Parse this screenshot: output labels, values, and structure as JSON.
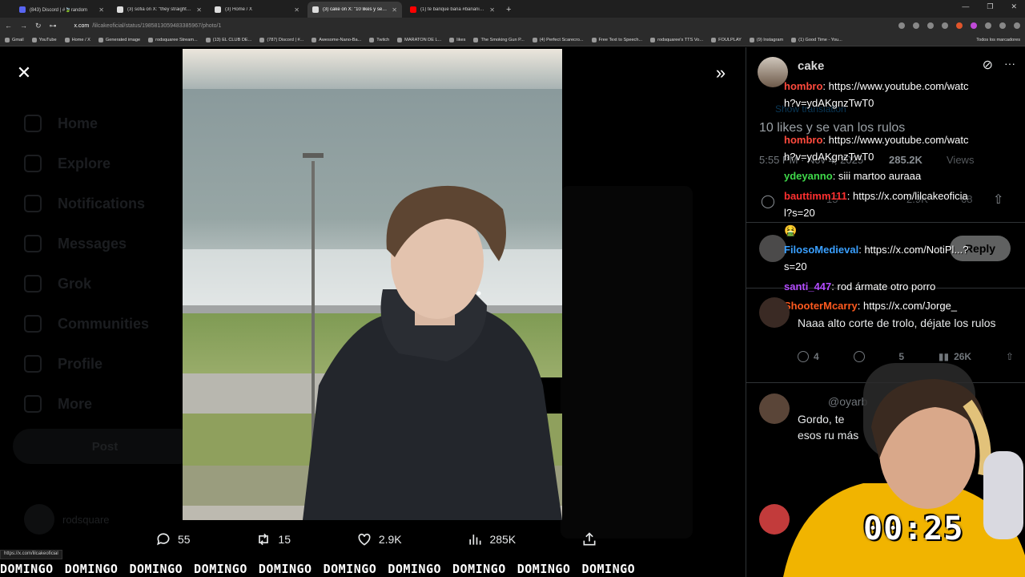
{
  "browser": {
    "tabs": [
      {
        "title": "(843) Discord | #🍃random",
        "color": "#5865f2",
        "active": false
      },
      {
        "title": "(3) sofia on X: \"they straight up",
        "color": "#ffffff",
        "active": false
      },
      {
        "title": "(3) Home / X",
        "color": "#ffffff",
        "active": false
      },
      {
        "title": "(3) cake on X: \"10 likes y se van",
        "color": "#ffffff",
        "active": true
      },
      {
        "title": "(1) te banque bana #bananirou",
        "color": "#ff0000",
        "active": false
      }
    ],
    "url_host": "x.com",
    "url_path": "/lilcakeoficial/status/1985813059483385967/photo/1",
    "bookmarks": [
      "Gmail",
      "YouTube",
      "Home / X",
      "Generated image",
      "rodsquaree Stream...",
      "(13) EL CLUB DE...",
      "(787) Discord | #...",
      "Awesome-Nano-Ba...",
      "Twitch",
      "MARATON DE L...",
      "likes",
      "The Smoking Gun P...",
      "(4) Perfect Scarecro...",
      "Free Text to Speech...",
      "rodsquaree's TTS Vo...",
      "FOULPLAY",
      "(9) Instagram",
      "(1) Good Time - You..."
    ],
    "bookmarks_all": "Todos los marcadores",
    "status_url": "https://x.com/lilcakeoficial"
  },
  "sidebar_ghost": {
    "items": [
      "Home",
      "Explore",
      "Notifications",
      "Messages",
      "Grok",
      "Communities",
      "Profile",
      "More"
    ],
    "post_label": "Post",
    "user_name": "rodsquare"
  },
  "actions": {
    "replies": "55",
    "reposts": "15",
    "likes": "2.9K",
    "views": "285K"
  },
  "ticker_word": "DOMINGO",
  "ticker_count": 10,
  "post": {
    "author": "cake",
    "show_translation": "Show translation",
    "text": "10 likes y se van los rulos",
    "meta_time": "5:55 PM · Nov 4, 2025",
    "meta_views": "285.2K",
    "meta_views_label": "Views",
    "stats": {
      "reposts": "15",
      "likes": "2.9K",
      "bookmarks": "68"
    },
    "reply_label": "Reply"
  },
  "chat": [
    {
      "user": "hombro",
      "color": "#ff4a3d",
      "text": "https://www.youtube.com/watch?v=ydAKgnzTwT0"
    },
    {
      "user": "hombro",
      "color": "#ff4a3d",
      "text": "https://www.youtube.com/watch?v=ydAKgnzTwT0"
    },
    {
      "user": "ydeyanno",
      "color": "#3fd84a",
      "text": "siii martoo auraaa"
    },
    {
      "user": "bauttimm111",
      "color": "#ff3030",
      "text": "https://x.com/lilcakeoficial?s=20"
    },
    {
      "user": "",
      "color": "#ffffff",
      "text": "🤮"
    },
    {
      "user": "FilosoMedieval",
      "color": "#3aa0ff",
      "text": "https://x.com/NotiPl...?s=20"
    },
    {
      "user": "santi_447",
      "color": "#b44dff",
      "text": "rod ármate otro porro"
    },
    {
      "user": "ShooterMcarry",
      "color": "#ff5a1f",
      "text": "https://x.com/Jorge_"
    }
  ],
  "replies": [
    {
      "text": "Naaa alto corte de trolo, déjate los rulos",
      "comments": "4",
      "reposts": "",
      "likes": "5",
      "views": "26K"
    },
    {
      "handle": "@oyarb",
      "text": "Gordo, te esos ru más",
      "comments": "",
      "reposts": "",
      "likes": "",
      "views": ""
    }
  ],
  "timer": "00:25"
}
